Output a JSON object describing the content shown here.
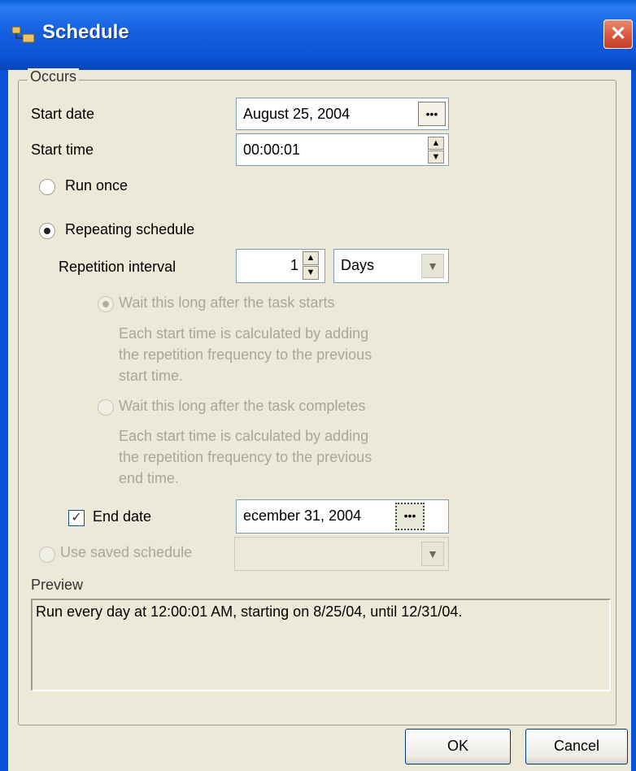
{
  "window": {
    "title": "Schedule",
    "close_glyph": "✕"
  },
  "occurs": {
    "group_label": "Occurs",
    "start_date_label": "Start date",
    "start_date_value": "August 25, 2004",
    "date_picker_glyph": "•••",
    "start_time_label": "Start time",
    "start_time_value": "00:00:01",
    "run_once_label": "Run once",
    "repeating_label": "Repeating schedule",
    "repetition_interval_label": "Repetition interval",
    "repetition_interval_value": "1",
    "repetition_unit": "Days",
    "wait_after_start_label": "Wait this long after the task starts",
    "wait_after_start_desc": [
      "Each start time is calculated by adding",
      "the repetition frequency to the previous",
      "start time."
    ],
    "wait_after_complete_label": "Wait this long after the task completes",
    "wait_after_complete_desc": [
      "Each start time is calculated by adding",
      "the repetition frequency to the previous",
      "end time."
    ],
    "end_date_label": "End date",
    "end_date_checked": true,
    "end_date_value": "ecember 31, 2004",
    "use_saved_label": "Use saved schedule",
    "use_saved_value": ""
  },
  "preview": {
    "label": "Preview",
    "text": "Run every day at 12:00:01 AM, starting on 8/25/04, until 12/31/04."
  },
  "buttons": {
    "ok": "OK",
    "cancel": "Cancel"
  },
  "colors": {
    "titlebar": "#0b54d4",
    "dialog_bg": "#ece9d8",
    "disabled_text": "#a7a699"
  }
}
